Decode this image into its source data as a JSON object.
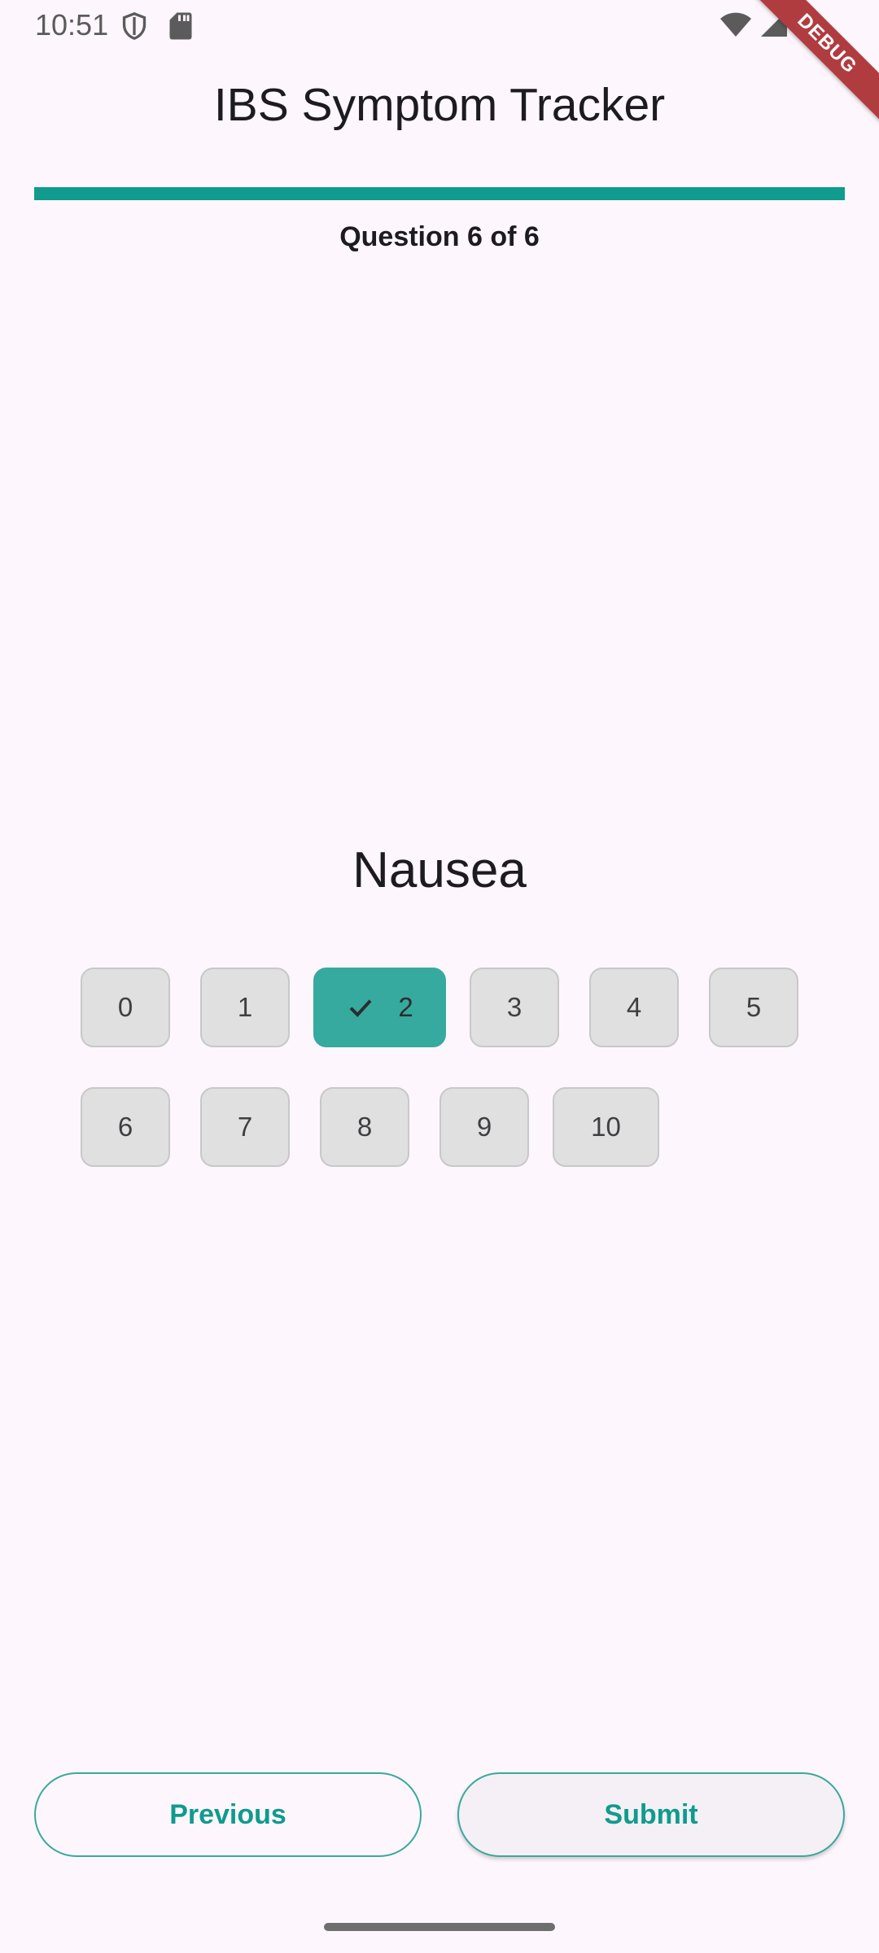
{
  "status_bar": {
    "time": "10:51",
    "icons": [
      "shield-icon",
      "sd-card-icon",
      "wifi-icon",
      "signal-icon",
      "battery-icon"
    ]
  },
  "debug_banner": "DEBUG",
  "app_bar": {
    "title": "IBS Symptom Tracker"
  },
  "progress": {
    "current": 6,
    "total": 6,
    "fraction": 1.0,
    "label": "Question 6 of 6"
  },
  "question": {
    "title": "Nausea",
    "options": [
      "0",
      "1",
      "2",
      "3",
      "4",
      "5",
      "6",
      "7",
      "8",
      "9",
      "10"
    ],
    "selected": "2"
  },
  "buttons": {
    "previous": "Previous",
    "submit": "Submit"
  },
  "colors": {
    "accent": "#0f9b8e",
    "chip_selected": "#36aa9e",
    "chip_default": "#e0e0e0",
    "background": "#fdf6fd",
    "debug_banner": "#b13c3f"
  }
}
